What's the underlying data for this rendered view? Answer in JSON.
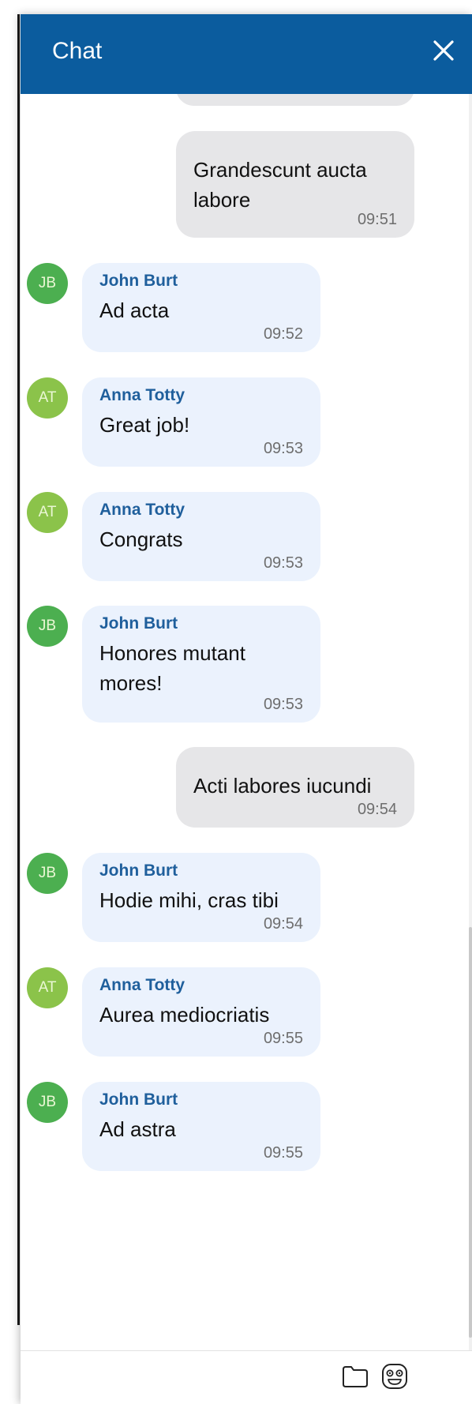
{
  "header": {
    "title": "Chat",
    "close_icon": "close-icon"
  },
  "messages": [
    {
      "direction": "outgoing",
      "lines": [
        "Grandescunt aucta",
        "labore"
      ],
      "time": "09:51"
    },
    {
      "direction": "incoming",
      "initials": "JB",
      "sender": "John Burt",
      "text": "Ad acta",
      "time": "09:52"
    },
    {
      "direction": "incoming",
      "initials": "AT",
      "sender": "Anna Totty",
      "text": "Great job!",
      "time": "09:53"
    },
    {
      "direction": "incoming",
      "initials": "AT",
      "sender": "Anna Totty",
      "text": "Congrats",
      "time": "09:53"
    },
    {
      "direction": "incoming",
      "initials": "JB",
      "sender": "John Burt",
      "lines": [
        "Honores mutant",
        "mores!"
      ],
      "time": "09:53"
    },
    {
      "direction": "outgoing",
      "text": "Acti labores iucundi",
      "time": "09:54"
    },
    {
      "direction": "incoming",
      "initials": "JB",
      "sender": "John Burt",
      "text": "Hodie mihi, cras tibi",
      "time": "09:54"
    },
    {
      "direction": "incoming",
      "initials": "AT",
      "sender": "Anna Totty",
      "text": "Aurea mediocriatis",
      "time": "09:55"
    },
    {
      "direction": "incoming",
      "initials": "JB",
      "sender": "John Burt",
      "text": "Ad astra",
      "time": "09:55"
    }
  ],
  "footer": {
    "attach_icon": "folder-icon",
    "emoji_icon": "emoji-icon"
  },
  "colors": {
    "header_bg": "#0b5c9e",
    "outgoing_bubble": "#e6e6e8",
    "incoming_bubble": "#ebf2fd",
    "sender_name": "#1f5f9c",
    "avatar_jb": "#4caf50",
    "avatar_at": "#8bc34a"
  }
}
